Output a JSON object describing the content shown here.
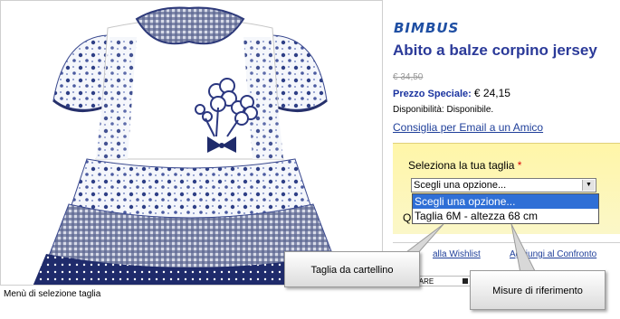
{
  "caption": "Menù di selezione taglia",
  "product": {
    "brand": "BIMBUS",
    "title": "Abito a balze corpino jersey",
    "old_price": "€ 34,50",
    "special_price_label": "Prezzo Speciale:",
    "special_price": "€ 24,15",
    "availability": "Disponibilità: Disponibile.",
    "email_link": "Consiglia per Email a un Amico"
  },
  "options": {
    "label": "Seleziona la tua taglia",
    "required_mark": "*",
    "selected": "Scegli una opzione...",
    "dropdown_items": [
      "Scegli una opzione...",
      "Taglia 6M - altezza 68 cm"
    ]
  },
  "quantity_label": "Q",
  "links": {
    "wishlist": "alla Wishlist",
    "compare": "Aggiungi al Confronto"
  },
  "share_label": "HARE",
  "callouts": {
    "size_tag": "Taglia da cartellino",
    "measurements": "Misure di riferimento"
  },
  "colors": {
    "accent_blue": "#1f3f9a",
    "highlight_yellow": "#fff6a8",
    "selection_blue": "#2f6fd6",
    "dress_navy": "#1f2b6b"
  },
  "icons": [
    "select-arrow-icon",
    "share-icon"
  ]
}
